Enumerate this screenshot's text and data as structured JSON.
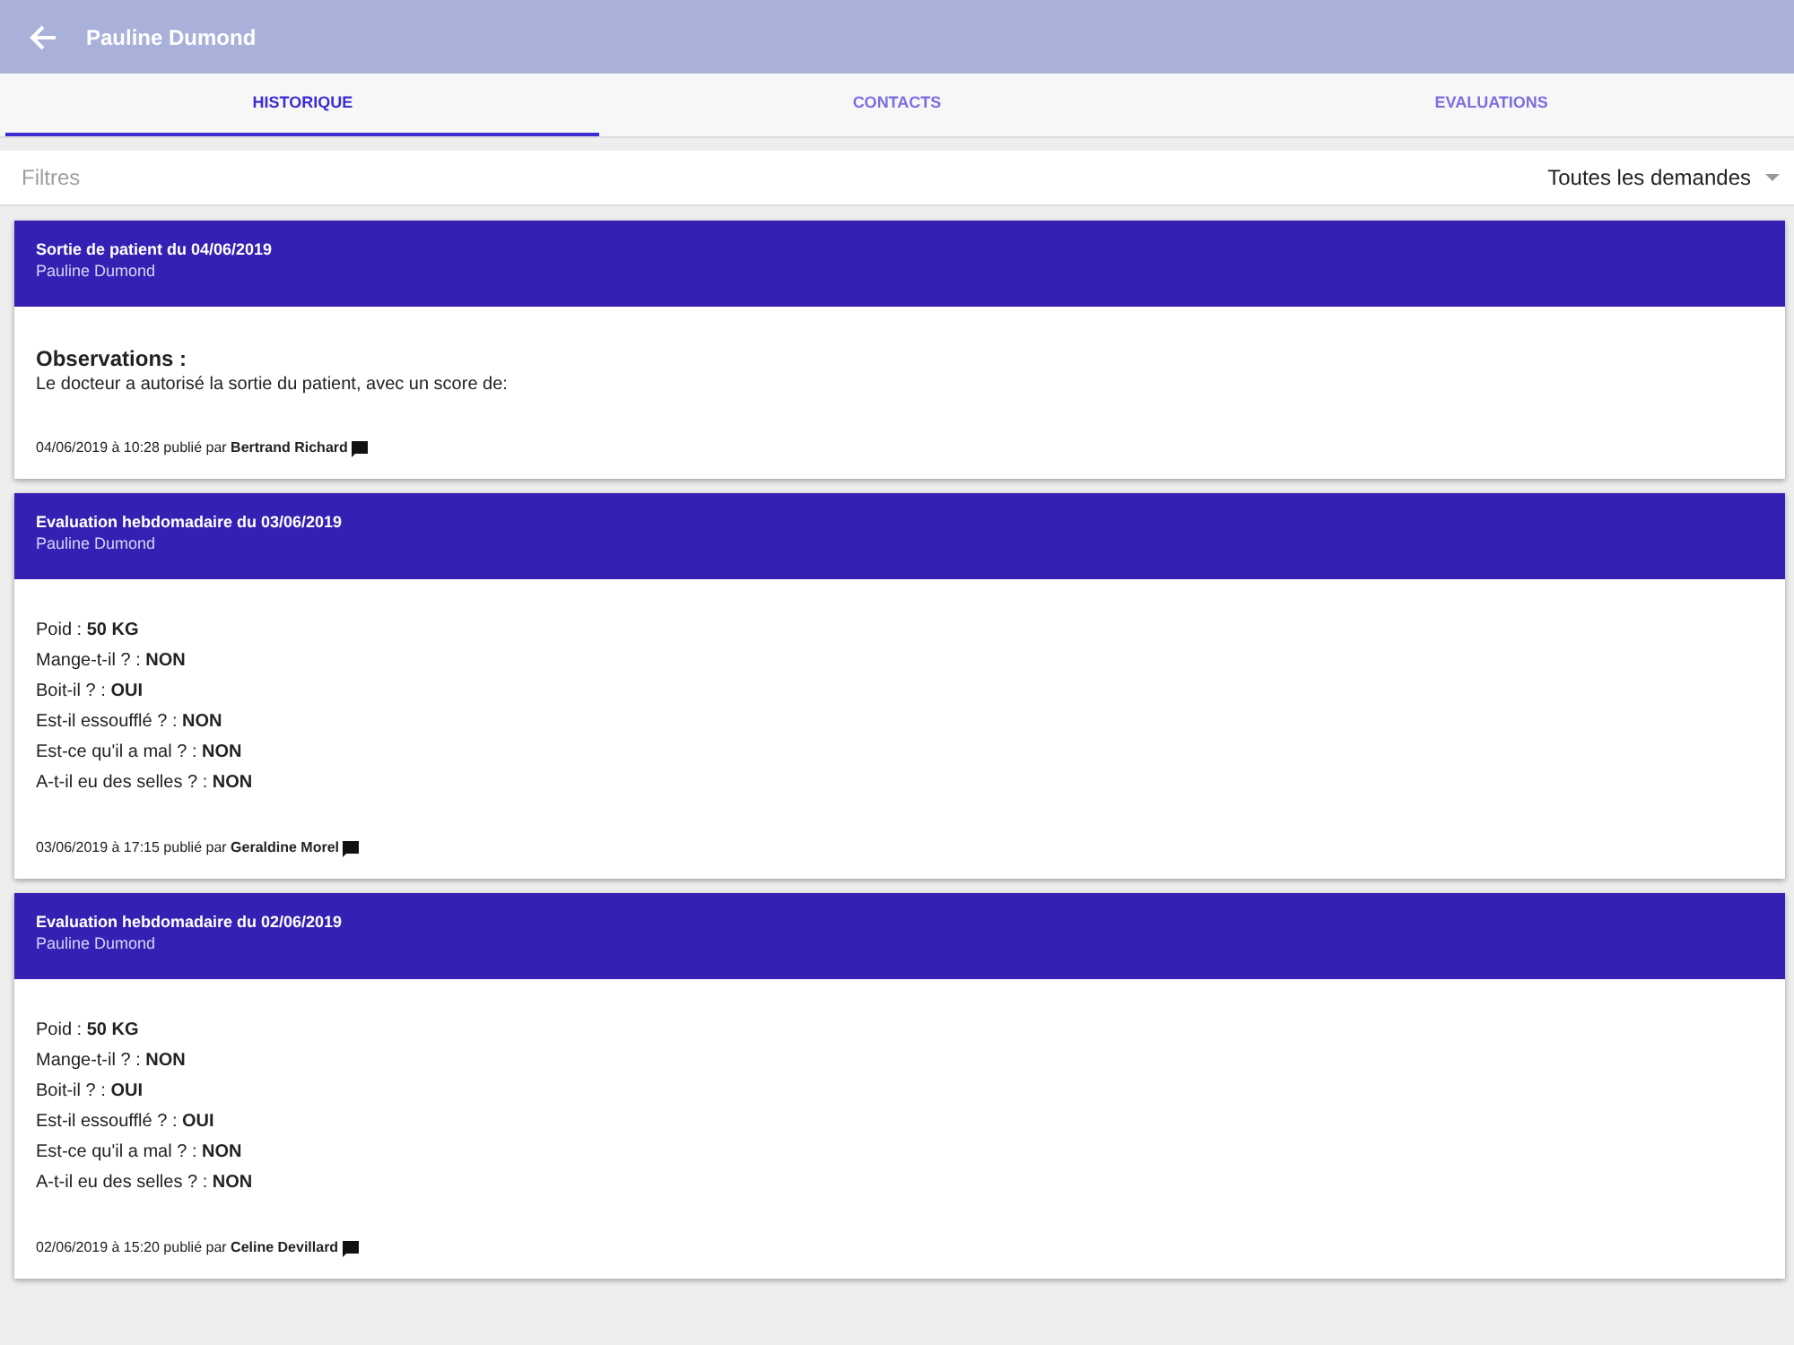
{
  "app_bar": {
    "title": "Pauline Dumond"
  },
  "tabs": [
    {
      "label": "HISTORIQUE",
      "selected": true
    },
    {
      "label": "CONTACTS",
      "selected": false
    },
    {
      "label": "EVALUATIONS",
      "selected": false
    }
  ],
  "filter_bar": {
    "label": "Filtres",
    "dropdown": "Toutes les demandes"
  },
  "cards": [
    {
      "kind": "observation",
      "title": "Sortie de patient du 04/06/2019",
      "subtitle": "Pauline Dumond",
      "heading": "Observations :",
      "text": "Le docteur a autorisé la sortie du patient, avec un score de:",
      "footer": "04/06/2019 à 10:28 publié par **Bertrand Richard**"
    },
    {
      "kind": "evaluation",
      "title": "Evaluation hebdomadaire du 03/06/2019",
      "subtitle": "Pauline Dumond",
      "lines": [
        "Poid : **50 KG**",
        "Mange-t-il ? : **NON**",
        "Boit-il ? : **OUI**",
        "Est-il essoufflé ? : **NON**",
        "Est-ce qu'il a mal ? : **NON**",
        "A-t-il eu des selles ? : **NON**"
      ],
      "footer": "03/06/2019 à 17:15 publié par **Geraldine Morel**"
    },
    {
      "kind": "evaluation",
      "title": "Evaluation hebdomadaire du 02/06/2019",
      "subtitle": "Pauline Dumond",
      "lines": [
        "Poid : **50 KG**",
        "Mange-t-il ? : **NON**",
        "Boit-il ? : **OUI**",
        "Est-il essoufflé ? : **OUI**",
        "Est-ce qu'il a mal ? : **NON**",
        "A-t-il eu des selles ? : **NON**"
      ],
      "footer": "02/06/2019 à 15:20 publié par **Celine Devillard**"
    }
  ]
}
